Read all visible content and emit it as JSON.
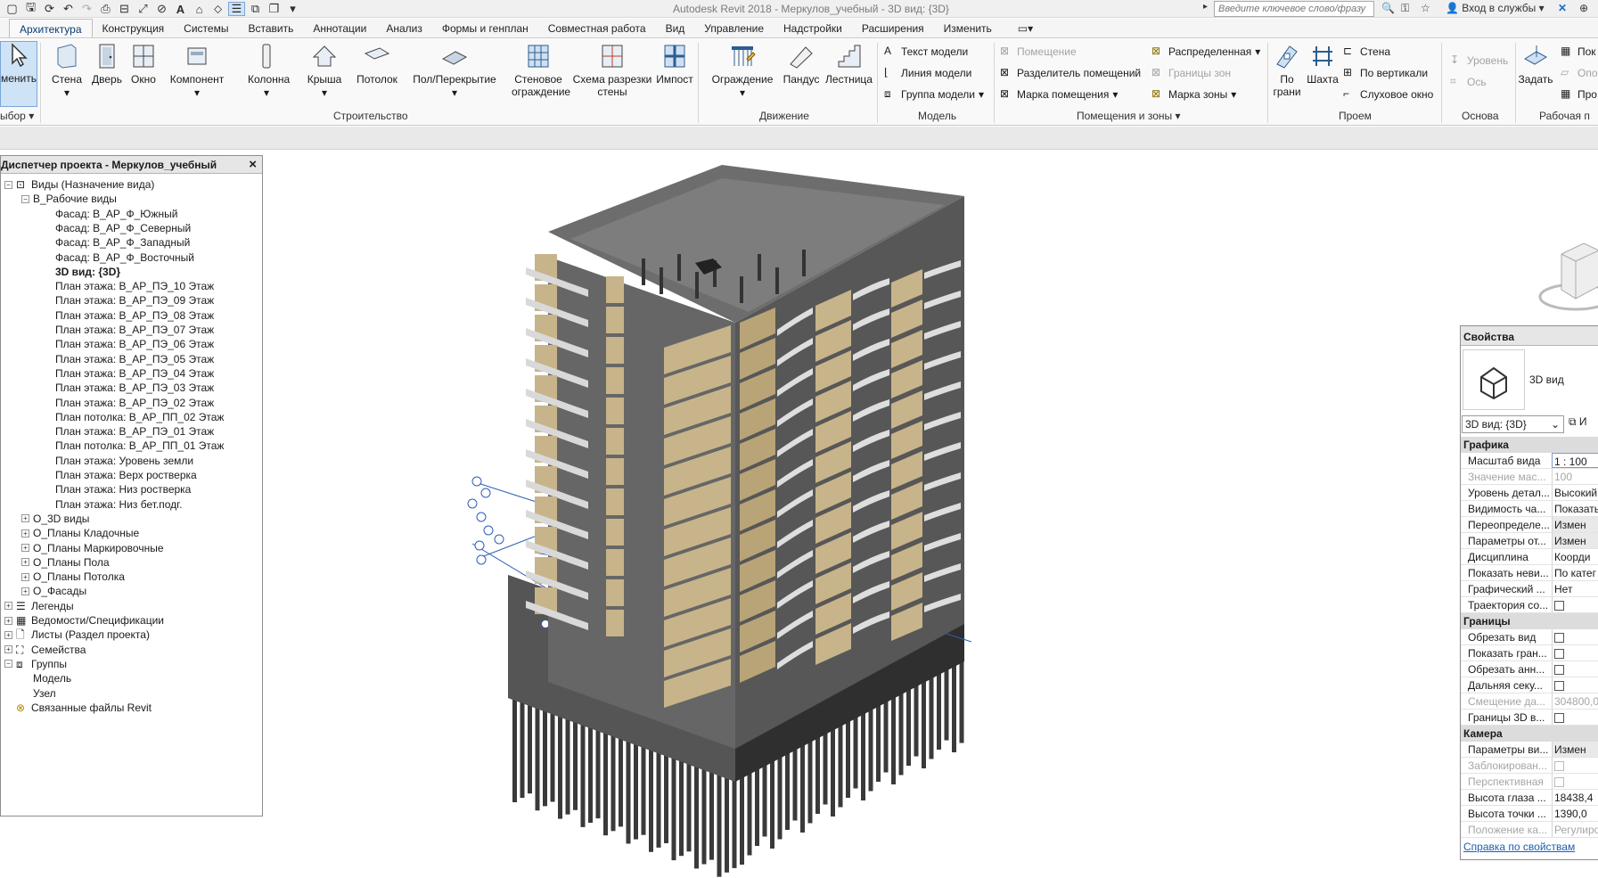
{
  "window": {
    "title": "Autodesk Revit 2018 -    Меркулов_учебный - 3D вид: {3D}",
    "search_placeholder": "Введите ключевое слово/фразу",
    "signin": "Вход в службы"
  },
  "tabs": [
    "Архитектура",
    "Конструкция",
    "Системы",
    "Вставить",
    "Аннотации",
    "Анализ",
    "Формы и генплан",
    "Совместная работа",
    "Вид",
    "Управление",
    "Надстройки",
    "Расширения",
    "Изменить"
  ],
  "ribbon": {
    "modify": "менить",
    "select_panel": "ыбор",
    "build_buttons": [
      "Стена",
      "Дверь",
      "Окно",
      "Компонент",
      "Колонна",
      "Крыша",
      "Потолок",
      "Пол/Перекрытие",
      "Стеновое\nограждение",
      "Схема разрезки\nстены",
      "Импост"
    ],
    "build_panel": "Строительство",
    "circulation_buttons": [
      "Ограждение",
      "Пандус",
      "Лестница"
    ],
    "circulation_panel": "Движение",
    "model_items": [
      "Текст модели",
      "Линия модели",
      "Группа модели"
    ],
    "model_panel": "Модель",
    "room_items_left": [
      "Помещение",
      "Разделитель помещений",
      "Марка помещения"
    ],
    "room_items_right": [
      "Распределенная",
      "Границы зон",
      "Марка зоны"
    ],
    "rooms_panel": "Помещения и зоны",
    "opening_big": [
      "По\nграни",
      "Шахта"
    ],
    "opening_small": [
      "Стена",
      "По вертикали",
      "Слуховое окно"
    ],
    "opening_panel": "Проем",
    "datum_items": [
      "Уровень",
      "Ось"
    ],
    "datum_panel": "Основа",
    "work_big": "Задать",
    "work_small": [
      "Пок",
      "Опо",
      "Про"
    ],
    "work_panel": "Рабочая п"
  },
  "browser": {
    "title": "Диспетчер проекта - Меркулов_учебный",
    "rows": [
      {
        "text": "Виды (Назначение вида)",
        "indent": 0,
        "tog": "−",
        "icon": "views"
      },
      {
        "text": "В_Рабочие виды",
        "indent": 1,
        "tog": "−"
      },
      {
        "text": "Фасад: В_АР_Ф_Южный",
        "indent": 3
      },
      {
        "text": "Фасад: В_АР_Ф_Северный",
        "indent": 3
      },
      {
        "text": "Фасад: В_АР_Ф_Западный",
        "indent": 3
      },
      {
        "text": "Фасад: В_АР_Ф_Восточный",
        "indent": 3
      },
      {
        "text": "3D вид: {3D}",
        "indent": 3,
        "bold": true
      },
      {
        "text": "План этажа: В_АР_ПЭ_10 Этаж",
        "indent": 3
      },
      {
        "text": "План этажа: В_АР_ПЭ_09 Этаж",
        "indent": 3
      },
      {
        "text": "План этажа: В_АР_ПЭ_08 Этаж",
        "indent": 3
      },
      {
        "text": "План этажа: В_АР_ПЭ_07 Этаж",
        "indent": 3
      },
      {
        "text": "План этажа: В_АР_ПЭ_06 Этаж",
        "indent": 3
      },
      {
        "text": "План этажа: В_АР_ПЭ_05 Этаж",
        "indent": 3
      },
      {
        "text": "План этажа: В_АР_ПЭ_04 Этаж",
        "indent": 3
      },
      {
        "text": "План этажа: В_АР_ПЭ_03 Этаж",
        "indent": 3
      },
      {
        "text": "План этажа: В_АР_ПЭ_02 Этаж",
        "indent": 3
      },
      {
        "text": "План потолка: В_АР_ПП_02 Этаж",
        "indent": 3
      },
      {
        "text": "План этажа: В_АР_ПЭ_01 Этаж",
        "indent": 3
      },
      {
        "text": "План потолка: В_АР_ПП_01 Этаж",
        "indent": 3
      },
      {
        "text": "План этажа: Уровень земли",
        "indent": 3
      },
      {
        "text": "План этажа: Верх ростверка",
        "indent": 3
      },
      {
        "text": "План этажа: Низ ростверка",
        "indent": 3
      },
      {
        "text": "План этажа: Низ бет.подг.",
        "indent": 3
      },
      {
        "text": "О_3D виды",
        "indent": 1,
        "tog": "+"
      },
      {
        "text": "О_Планы Кладочные",
        "indent": 1,
        "tog": "+"
      },
      {
        "text": "О_Планы Маркировочные",
        "indent": 1,
        "tog": "+"
      },
      {
        "text": "О_Планы Пола",
        "indent": 1,
        "tog": "+"
      },
      {
        "text": "О_Планы Потолка",
        "indent": 1,
        "tog": "+"
      },
      {
        "text": "О_Фасады",
        "indent": 1,
        "tog": "+"
      },
      {
        "text": "Легенды",
        "indent": 0,
        "tog": "+",
        "icon": "legend"
      },
      {
        "text": "Ведомости/Спецификации",
        "indent": 0,
        "tog": "+",
        "icon": "schedule"
      },
      {
        "text": "Листы (Раздел проекта)",
        "indent": 0,
        "tog": "+",
        "icon": "sheet"
      },
      {
        "text": "Семейства",
        "indent": 0,
        "tog": "+",
        "icon": "family"
      },
      {
        "text": "Группы",
        "indent": 0,
        "tog": "−",
        "icon": "group"
      },
      {
        "text": "Модель",
        "indent": 1
      },
      {
        "text": "Узел",
        "indent": 1
      },
      {
        "text": "Связанные файлы Revit",
        "indent": 0,
        "icon": "link"
      }
    ]
  },
  "properties": {
    "title": "Свойства",
    "type_label": "3D вид",
    "selector": "3D вид: {3D}",
    "edit_type": "И",
    "sections": [
      {
        "name": "Графика",
        "rows": [
          {
            "n": "Масштаб вида",
            "v": "1 : 100",
            "kind": "input"
          },
          {
            "n": "Значение мас...",
            "v": "100",
            "dis": true
          },
          {
            "n": "Уровень детал...",
            "v": "Высокий"
          },
          {
            "n": "Видимость ча...",
            "v": "Показать"
          },
          {
            "n": "Переопределе...",
            "v": "Измен",
            "kind": "btn"
          },
          {
            "n": "Параметры от...",
            "v": "Измен",
            "kind": "btn"
          },
          {
            "n": "Дисциплина",
            "v": "Коорди"
          },
          {
            "n": "Показать неви...",
            "v": "По катег"
          },
          {
            "n": "Графический ...",
            "v": "Нет"
          },
          {
            "n": "Траектория со...",
            "v": "",
            "kind": "cb"
          }
        ]
      },
      {
        "name": "Границы",
        "rows": [
          {
            "n": "Обрезать вид",
            "v": "",
            "kind": "cb"
          },
          {
            "n": "Показать гран...",
            "v": "",
            "kind": "cb"
          },
          {
            "n": "Обрезать анн...",
            "v": "",
            "kind": "cb"
          },
          {
            "n": "Дальняя секу...",
            "v": "",
            "kind": "cb"
          },
          {
            "n": "Смещение да...",
            "v": "304800,0",
            "dis": true
          },
          {
            "n": "Границы 3D в...",
            "v": "",
            "kind": "cb"
          }
        ]
      },
      {
        "name": "Камера",
        "rows": [
          {
            "n": "Параметры ви...",
            "v": "Измен",
            "kind": "btn"
          },
          {
            "n": "Заблокирован...",
            "v": "",
            "kind": "cb",
            "dis": true
          },
          {
            "n": "Перспективная",
            "v": "",
            "kind": "cb",
            "dis": true
          },
          {
            "n": "Высота глаза ...",
            "v": "18438,4"
          },
          {
            "n": "Высота точки ...",
            "v": "1390,0"
          },
          {
            "n": "Положение ка...",
            "v": "Регулиро",
            "dis": true
          }
        ]
      }
    ],
    "help_link": "Справка по свойствам"
  },
  "colors": {
    "facade": "#c8b48a",
    "concrete": "#5c5c5c",
    "slab": "#9b9b9b",
    "piles": "#3a3a3a",
    "ribbon_bg": "#f9f9f9",
    "accent": "#0a3b75"
  }
}
